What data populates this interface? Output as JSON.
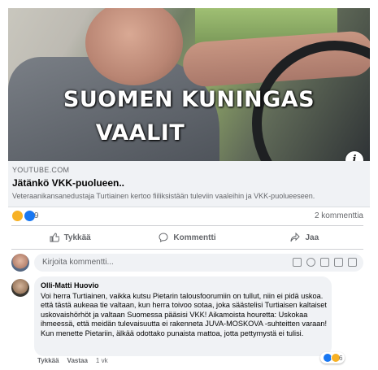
{
  "video": {
    "caption_line1": "SUOMEN KUNINGAS",
    "caption_line2": "VAALIT",
    "info_icon": "i"
  },
  "link": {
    "source": "YOUTUBE.COM",
    "title": "Jätänkö VKK-puolueen..",
    "description": "Veteraanikansanedustaja Turtiainen kertoo fiiliksistään tuleviin vaaleihin ja VKK-puolueeseen."
  },
  "stats": {
    "reaction_icons": [
      "haha-icon",
      "like-icon"
    ],
    "reaction_count": "9",
    "comments_count": "2 kommenttia"
  },
  "actions": {
    "like": "Tykkää",
    "comment": "Kommentti",
    "share": "Jaa"
  },
  "composer": {
    "placeholder": "Kirjoita kommentti...",
    "icons": [
      "emoji-icon",
      "camera-icon",
      "gif-icon",
      "sticker-icon"
    ]
  },
  "comment": {
    "author": "Olli-Matti Huovio",
    "text": "Voi herra Turtiainen, vaikka kutsu Pietarin talousfoorumiin on tullut, niin ei pidä uskoa. että tästä aukeaa tie valtaan, kun herra toivoo sotaa, joka säästelisi Turtiaisen kaltaiset uskovaishörhöt ja valtaan Suomessa pääsisi VKK! Aikamoista hourettа: Uskokaa ihmeessä, että meidän tulevaisuutta ei rakenneta JUVA-MOSKOVA -suhteitten varaan! Kun menette Pietariin, älkää odottako punaista mattoa, jotta pettymystä ei tulisi.",
    "like_label": "Tykkää",
    "reply_label": "Vastaa",
    "time": "1 vk",
    "reaction_count": "6"
  },
  "colors": {
    "facebook_blue": "#1877f2",
    "haha_yellow": "#f7b125",
    "secondary_text": "#65676b",
    "link_bg": "#f0f2f5"
  }
}
